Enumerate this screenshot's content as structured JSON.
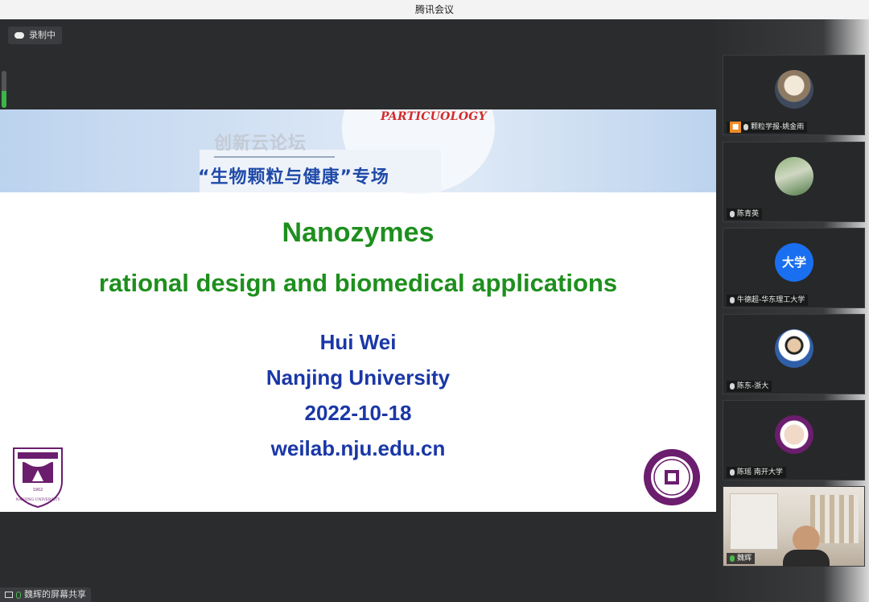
{
  "window": {
    "title": "腾讯会议"
  },
  "recording": {
    "label": "录制中",
    "mic_level": 0.45
  },
  "slide": {
    "journal": "PARTICUOLOGY",
    "forum": "创新云论坛",
    "special_session": "“生物颗粒与健康”专场",
    "title": "Nanozymes",
    "subtitle": "rational design and biomedical applications",
    "author": "Hui Wei",
    "affiliation": "Nanjing University",
    "date": "2022-10-18",
    "website": "weilab.nju.edu.cn",
    "left_logo_text": "NANJING UNIVERSITY",
    "left_logo_year": "1902"
  },
  "share_bar": {
    "label": "魏辉的屏幕共享"
  },
  "participants": [
    {
      "name": "颗粒学报-姚金雨",
      "host": true,
      "avatar": "photo-cat"
    },
    {
      "name": "陈青英",
      "host": false,
      "avatar": "photo-landscape"
    },
    {
      "name": "牛德超-华东理工大学",
      "host": false,
      "avatar": "text",
      "avatar_text": "大学"
    },
    {
      "name": "陈东-浙大",
      "host": false,
      "avatar": "photo-person"
    },
    {
      "name": "陈瑶 南开大学",
      "host": false,
      "avatar": "photo-nankai"
    },
    {
      "name": "魏辉",
      "host": false,
      "avatar": "video"
    }
  ],
  "colors": {
    "title_green": "#1e8f1e",
    "info_blue": "#1a37a6",
    "accent_red": "#d22b2b",
    "nju_purple": "#6b1d6e"
  }
}
